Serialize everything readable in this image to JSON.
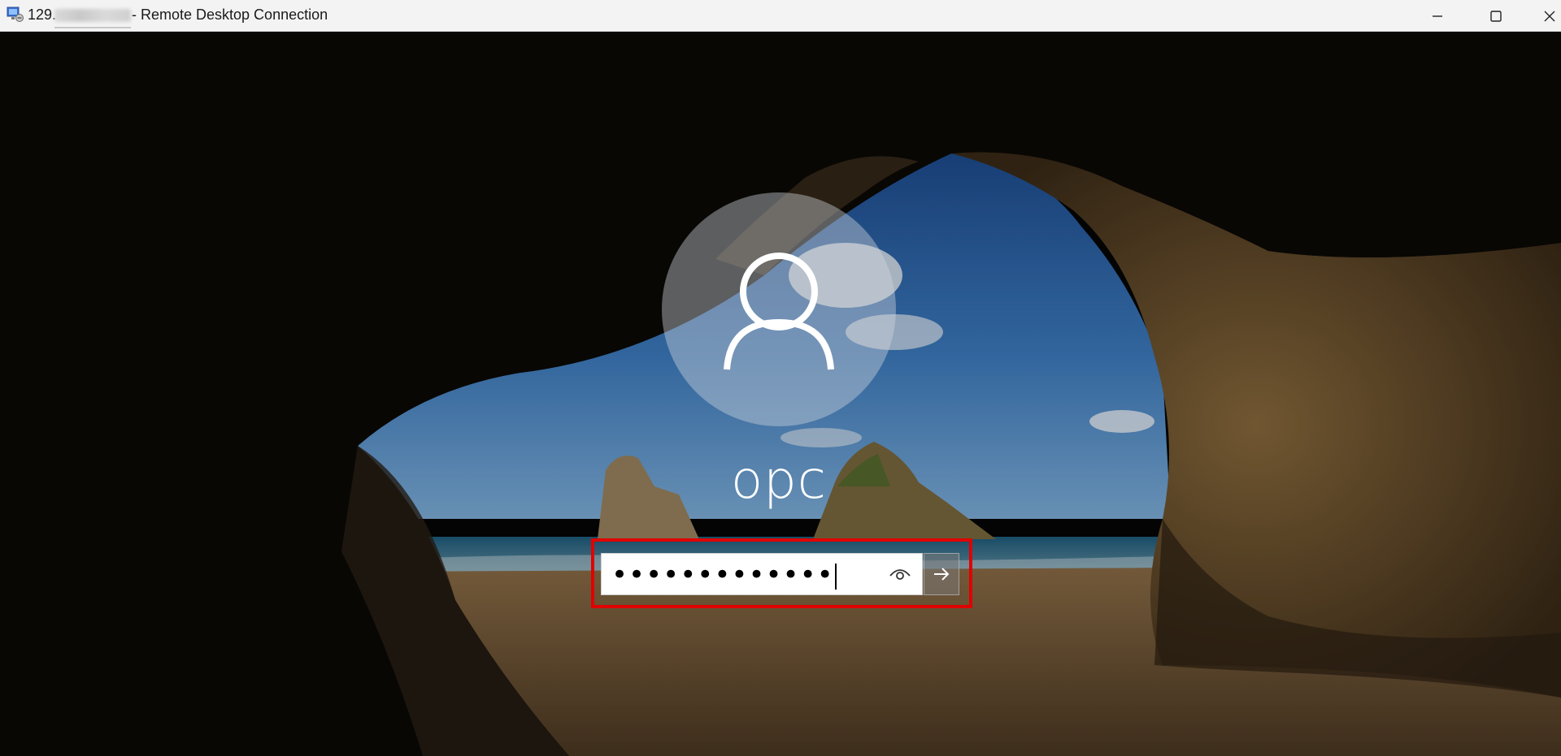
{
  "window": {
    "title_ip_visible": "129.",
    "title_suffix": "- Remote Desktop Connection",
    "icons": [
      "remote-desktop-icon",
      "minimize-icon",
      "maximize-icon",
      "close-icon"
    ]
  },
  "login": {
    "username": "opc",
    "password_masked": "•••••••••••••",
    "icons": [
      "user-avatar-icon",
      "eye-icon",
      "arrow-right-icon"
    ]
  },
  "colors": {
    "highlight": "#e00000",
    "titlebar": "#f3f3f3"
  }
}
